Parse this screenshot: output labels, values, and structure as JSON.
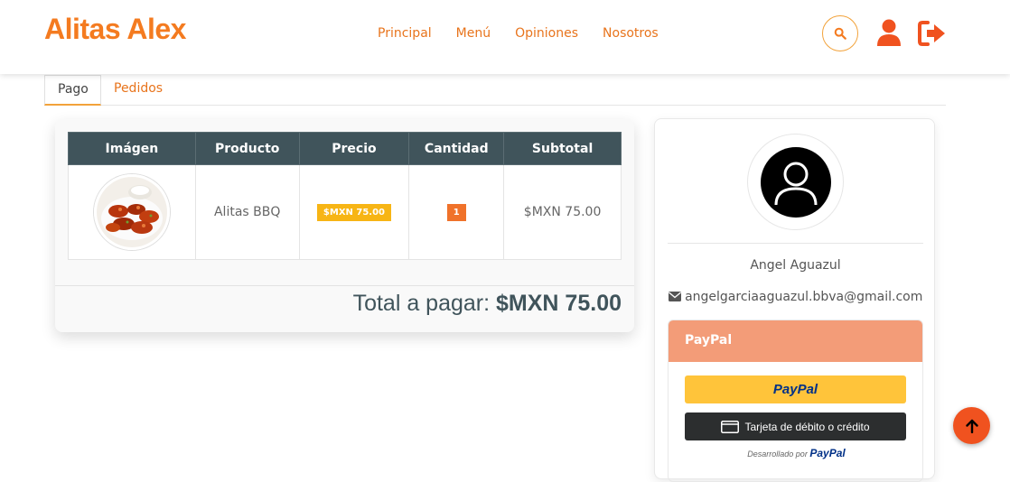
{
  "header": {
    "brand": "Alitas Alex",
    "nav": [
      "Principal",
      "Menú",
      "Opiniones",
      "Nosotros"
    ],
    "icons": [
      "search-icon",
      "user-icon",
      "logout-icon"
    ]
  },
  "tabs": [
    {
      "label": "Pago",
      "active": true
    },
    {
      "label": "Pedidos",
      "active": false
    }
  ],
  "cart": {
    "columns": [
      "Imágen",
      "Producto",
      "Precio",
      "Cantidad",
      "Subtotal"
    ],
    "rows": [
      {
        "product": "Alitas BBQ",
        "price": "$MXN 75.00",
        "quantity": "1",
        "subtotal": "$MXN 75.00"
      }
    ],
    "total_label": "Total a pagar:",
    "total_value": "$MXN 75.00"
  },
  "profile": {
    "name": "Angel Aguazul",
    "email": "angelgarciaaguazul.bbva@gmail.com"
  },
  "payment": {
    "header": "PayPal",
    "paypal_button": "PayPal",
    "card_button": "Tarjeta de débito o crédito",
    "powered_prefix": "Desarrollado por",
    "powered_brand": "PayPal"
  },
  "colors": {
    "accent": "#f47b20",
    "table_header": "#40545b",
    "price_badge": "#f7b515",
    "qty_badge": "#f0722a",
    "paypal_header": "#f39c78",
    "scroll_button": "#f0521f"
  }
}
